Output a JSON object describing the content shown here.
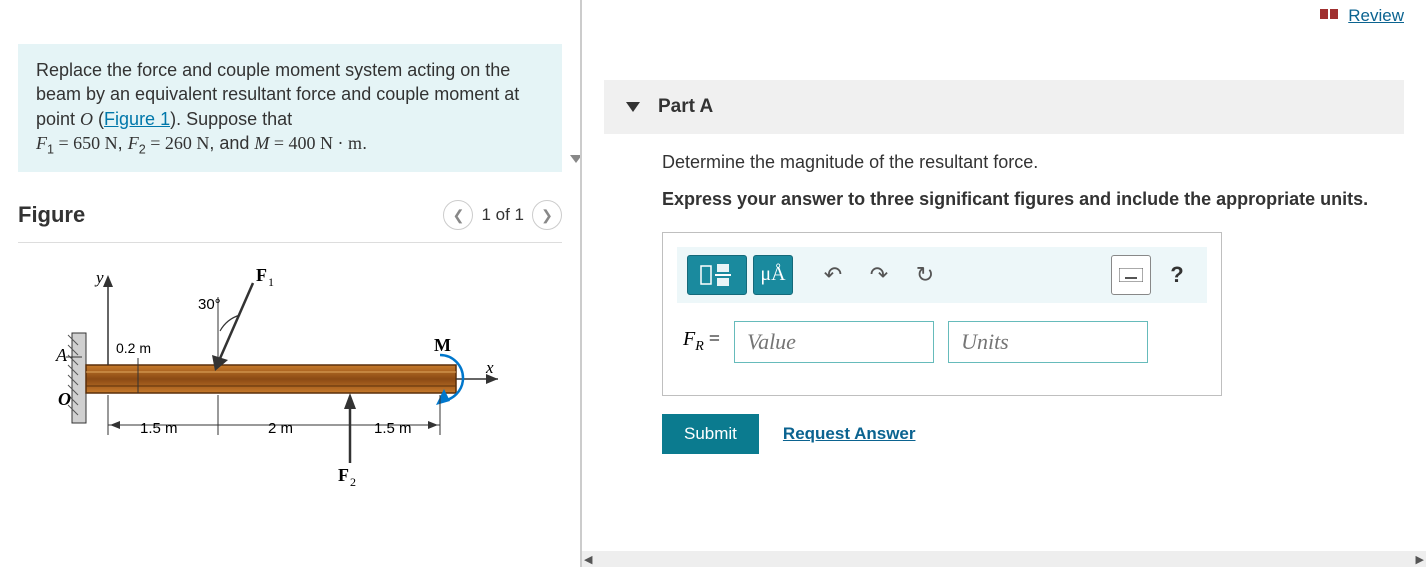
{
  "review": {
    "label": "Review"
  },
  "problem": {
    "text_prefix": "Replace the force and couple moment system acting on the beam by an equivalent resultant force and couple moment at point ",
    "point": "O",
    "fig_ref": "Figure 1",
    "text_suppose": ". Suppose that",
    "F1_label": "F",
    "F1_sub": "1",
    "F1_val": " = 650 N",
    "sep1": ", ",
    "F2_label": "F",
    "F2_sub": "2",
    "F2_val": " = 260 N",
    "sep2": ", and ",
    "M_label": "M",
    "M_val": " = 400 N · m",
    "period": "."
  },
  "figure": {
    "title": "Figure",
    "nav": "1 of 1",
    "labels": {
      "y": "y",
      "x": "x",
      "A": "A",
      "O": "O",
      "F1": "F",
      "F1s": "1",
      "F2": "F",
      "F2s": "2",
      "M": "M",
      "angle": "30°",
      "d1": "0.2 m",
      "d2": "1.5 m",
      "d3": "2 m",
      "d4": "1.5 m"
    }
  },
  "part": {
    "title": "Part A",
    "prompt": "Determine the magnitude of the resultant force.",
    "instruction": "Express your answer to three significant figures and include the appropriate units."
  },
  "toolbar": {
    "units_symbol": "μÅ",
    "help": "?"
  },
  "input": {
    "var": "F",
    "var_sub": "R",
    "equals": " =",
    "value_placeholder": "Value",
    "units_placeholder": "Units"
  },
  "actions": {
    "submit": "Submit",
    "request": "Request Answer"
  }
}
